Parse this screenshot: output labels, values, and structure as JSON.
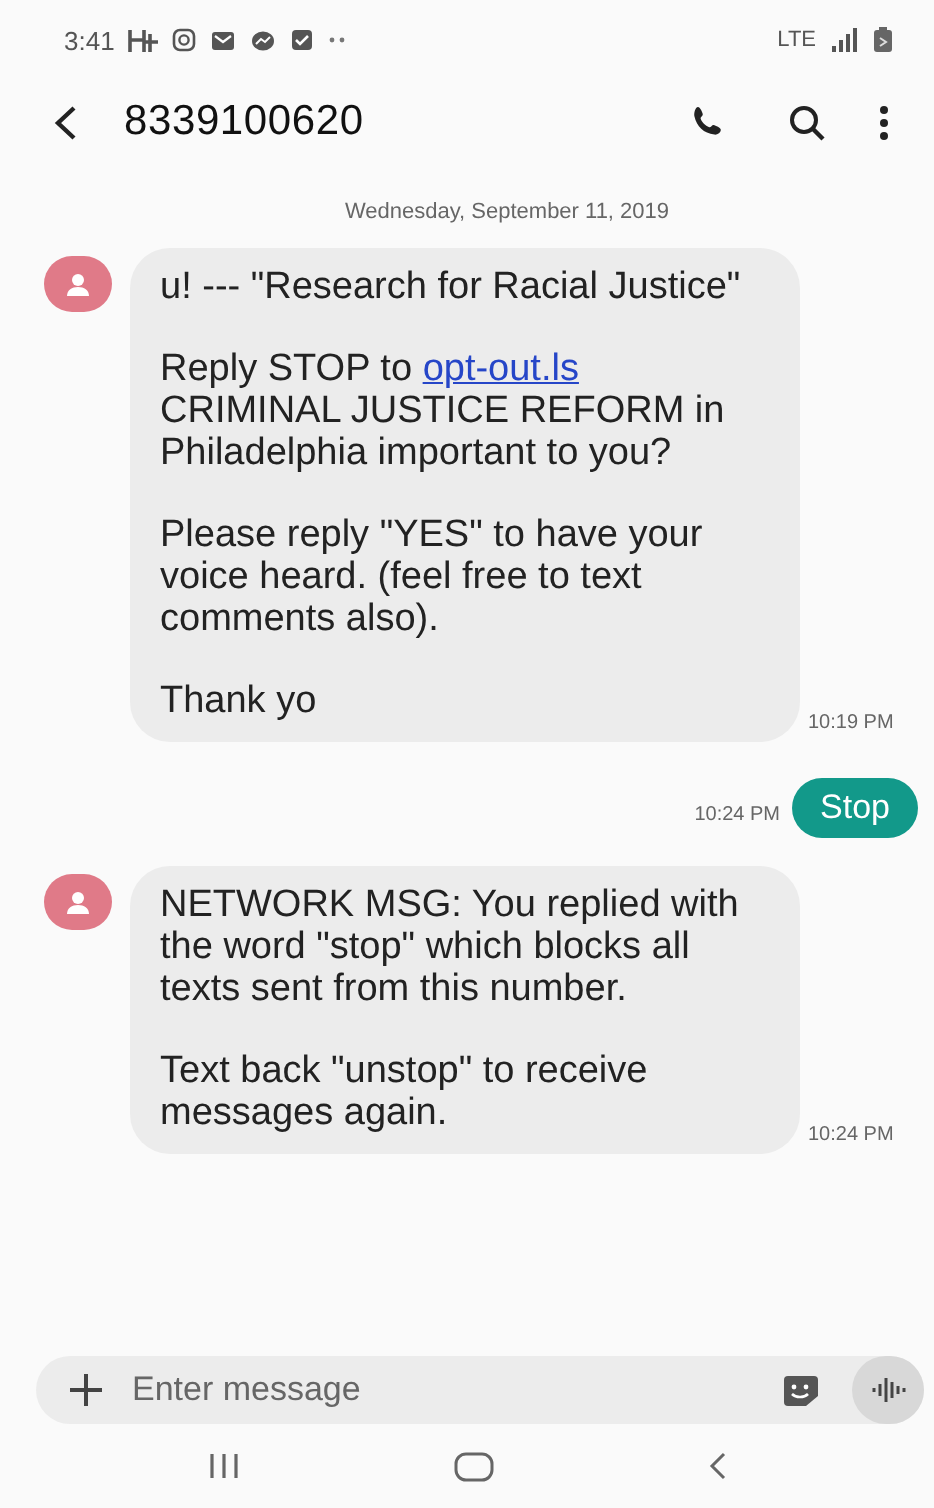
{
  "status_bar": {
    "time": "3:41",
    "network": "LTE"
  },
  "header": {
    "title": "8339100620"
  },
  "date_divider": "Wednesday, September 11, 2019",
  "messages": [
    {
      "kind": "received",
      "time": "10:19 PM",
      "paragraphs": [
        [
          {
            "kind": "text",
            "text": "u! --- \"Research for Racial Justice\""
          }
        ],
        [
          {
            "kind": "text",
            "text": "Reply STOP to "
          },
          {
            "kind": "link",
            "text": "opt-out.ls"
          },
          {
            "kind": "text",
            "text": " CRIMINAL JUSTICE REFORM in Philadelphia important to you?"
          }
        ],
        [
          {
            "kind": "text",
            "text": "Please reply \"YES\" to have your voice heard. (feel free to text comments also)."
          }
        ],
        [
          {
            "kind": "text",
            "text": "Thank yo"
          }
        ]
      ]
    },
    {
      "kind": "sent",
      "time": "10:24 PM",
      "paragraphs": [
        [
          {
            "kind": "text",
            "text": "Stop"
          }
        ]
      ]
    },
    {
      "kind": "received",
      "time": "10:24 PM",
      "paragraphs": [
        [
          {
            "kind": "text",
            "text": "NETWORK MSG: You replied with the word \"stop\" which blocks all texts sent from this number."
          }
        ],
        [
          {
            "kind": "text",
            "text": "Text back \"unstop\" to receive messages again."
          }
        ]
      ]
    }
  ],
  "composer": {
    "placeholder": "Enter message"
  }
}
